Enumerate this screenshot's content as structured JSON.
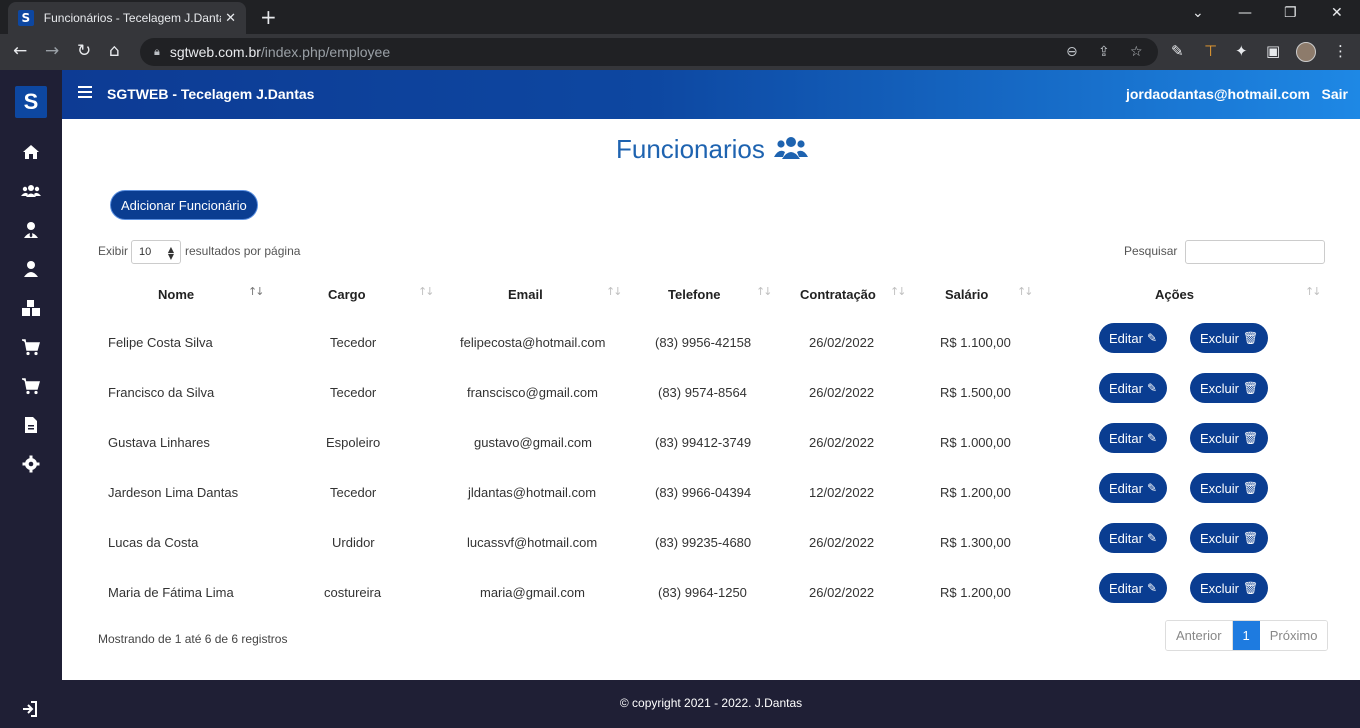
{
  "browser": {
    "tab_title": "Funcionários - Tecelagem J.Dantas",
    "tab_close": "✕",
    "new_tab": "+",
    "url_domain": "sgtweb.com.br",
    "url_path": "/index.php/employee",
    "window_controls": [
      "⌄",
      "—",
      "❐",
      "✕"
    ]
  },
  "sidebar": {
    "logo": "S",
    "items": [
      "home-icon",
      "users-icon",
      "user-tie-icon",
      "user-icon",
      "boxes-icon",
      "cart-icon",
      "cart-plus-icon",
      "file-icon",
      "gear-icon"
    ],
    "exit_icon": "sign-out-icon"
  },
  "navbar": {
    "title": "SGTWEB - Tecelagem J.Dantas",
    "user_email": "jordaodantas@hotmail.com",
    "logout": "Sair"
  },
  "page": {
    "title": "Funcionarios",
    "add_button": "Adicionar Funcionário"
  },
  "table_controls": {
    "show_label": "Exibir",
    "page_length": "10",
    "per_page_label": "resultados por página",
    "search_label": "Pesquisar",
    "search_value": ""
  },
  "table": {
    "headers": [
      "Nome",
      "Cargo",
      "Email",
      "Telefone",
      "Contratação",
      "Salário",
      "Ações"
    ],
    "rows": [
      {
        "nome": "Felipe Costa Silva",
        "cargo": "Tecedor",
        "email": "felipecosta@hotmail.com",
        "telefone": "(83) 9956-42158",
        "contratacao": "26/02/2022",
        "salario": "R$ 1.100,00"
      },
      {
        "nome": "Francisco da Silva",
        "cargo": "Tecedor",
        "email": "franscisco@gmail.com",
        "telefone": "(83) 9574-8564",
        "contratacao": "26/02/2022",
        "salario": "R$ 1.500,00"
      },
      {
        "nome": "Gustava Linhares",
        "cargo": "Espoleiro",
        "email": "gustavo@gmail.com",
        "telefone": "(83) 99412-3749",
        "contratacao": "26/02/2022",
        "salario": "R$ 1.000,00"
      },
      {
        "nome": "Jardeson Lima Dantas",
        "cargo": "Tecedor",
        "email": "jldantas@hotmail.com",
        "telefone": "(83) 9966-04394",
        "contratacao": "12/02/2022",
        "salario": "R$ 1.200,00"
      },
      {
        "nome": "Lucas da Costa",
        "cargo": "Urdidor",
        "email": "lucassvf@hotmail.com",
        "telefone": "(83) 99235-4680",
        "contratacao": "26/02/2022",
        "salario": "R$ 1.300,00"
      },
      {
        "nome": "Maria de Fátima Lima",
        "cargo": "costureira",
        "email": "maria@gmail.com",
        "telefone": "(83) 9964-1250",
        "contratacao": "26/02/2022",
        "salario": "R$ 1.200,00"
      }
    ],
    "edit_label": "Editar",
    "delete_label": "Excluir",
    "info": "Mostrando de 1 até 6 de 6 registros"
  },
  "pagination": {
    "previous": "Anterior",
    "current": "1",
    "next": "Próximo"
  },
  "footer": {
    "text": "© copyright 2021 - 2022. J.Dantas"
  },
  "colors": {
    "sidebar": "#1f1f35",
    "brand_blue": "#0a3d91",
    "title_blue": "#1e63b0"
  }
}
